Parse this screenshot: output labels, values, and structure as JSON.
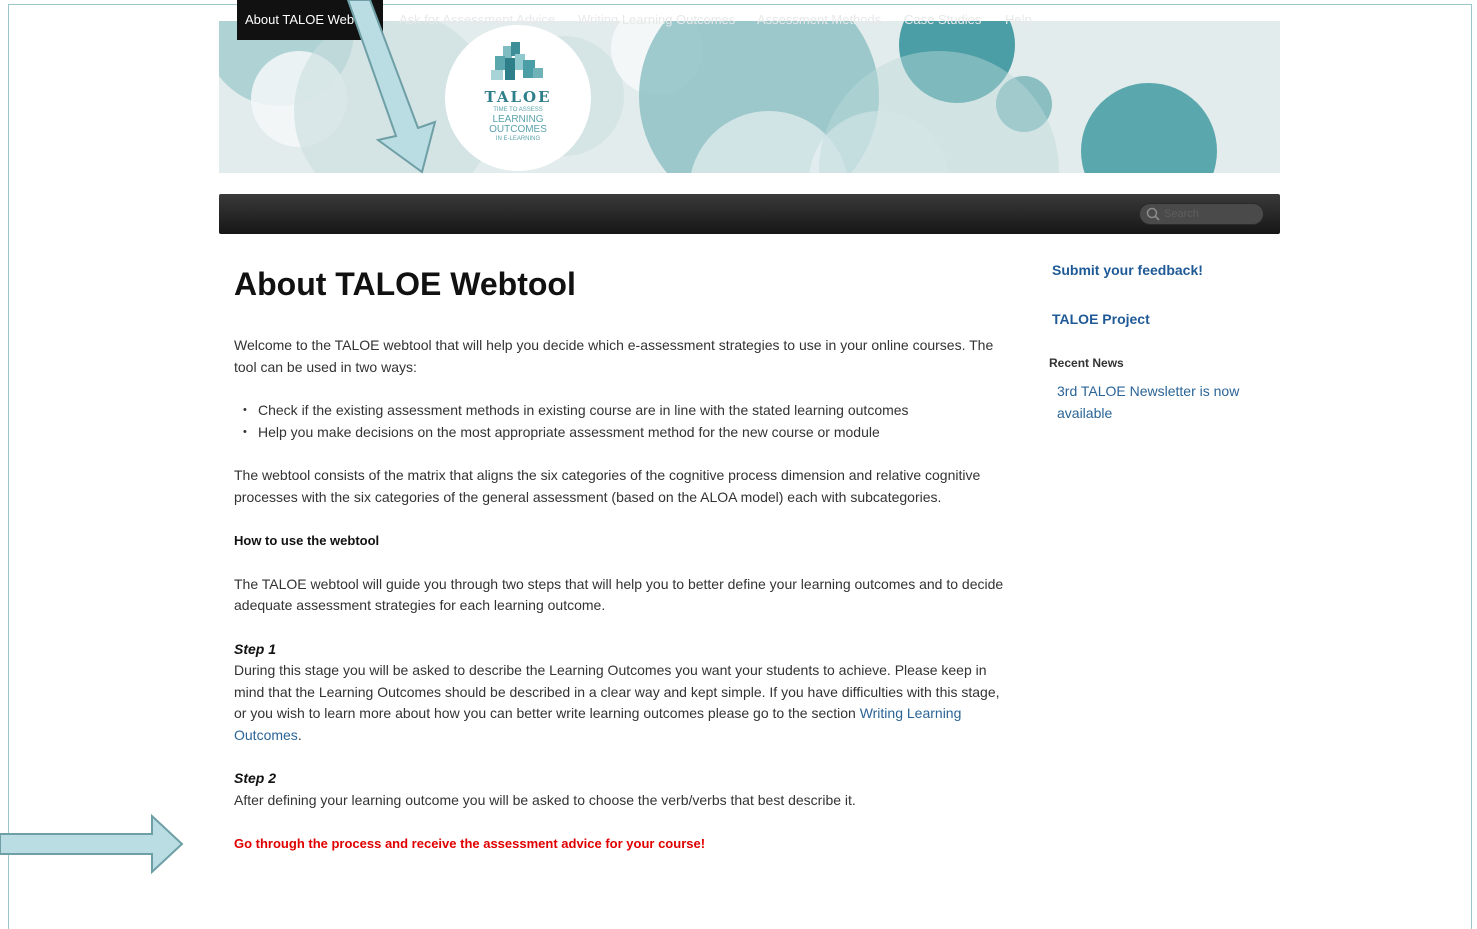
{
  "logo": {
    "word": "TALOE",
    "tagline_1": "TIME TO ASSESS",
    "tagline_2": "LEARNING",
    "tagline_3": "OUTCOMES",
    "tagline_4": "IN E-LEARNING"
  },
  "nav": {
    "items": [
      {
        "label": "About TALOE Webtool",
        "active": true
      },
      {
        "label": "Ask for Assessment Advice"
      },
      {
        "label": "Writing Learning Outcomes"
      },
      {
        "label": "Assessment Methods"
      },
      {
        "label": "Case Studies"
      },
      {
        "label": "Help"
      }
    ],
    "search_placeholder": "Search"
  },
  "main": {
    "title": "About TALOE Webtool",
    "intro": "Welcome to the TALOE webtool that will help you decide which e-assessment strategies to use in your online courses. The tool can be used in two ways:",
    "bullets": [
      "Check if the existing assessment methods in existing course are in line with the stated learning outcomes",
      "Help you make decisions on the most appropriate assessment method for the new course or module"
    ],
    "matrix_text": "The webtool consists of the matrix that aligns the six categories of the cognitive process dimension and relative cognitive processes with the six categories of the general assessment (based on the ALOA model) each with subcategories.",
    "how_to_heading": "How to use the webtool",
    "how_to_text": "The TALOE webtool will guide you through two steps that will help you to better define your learning outcomes and to decide adequate assessment strategies for each learning outcome.",
    "step1_title": "Step 1",
    "step1_text": "During this stage you will be asked to describe the Learning Outcomes you want your students to achieve. Please keep in mind that the Learning Outcomes should be described in a clear way and kept simple. If you have difficulties with this stage, or you wish to learn more about how you can better write learning outcomes please go to the section ",
    "step1_link": "Writing Learning Outcomes",
    "step1_end": ".",
    "step2_title": "Step 2",
    "step2_text": "After defining your learning outcome you will be asked to choose the verb/verbs that best describe it.",
    "cta": "Go through the process and receive the assessment advice for your course!"
  },
  "sidebar": {
    "feedback_link": "Submit your feedback!",
    "project_link": "TALOE Project",
    "recent_news_title": "Recent News",
    "news_item": "3rd TALOE Newsletter is now available"
  },
  "colors": {
    "accent_teal": "#5aa8ae",
    "link_blue": "#2a6496",
    "cta_red": "#e00000",
    "nav_dark": "#1c1c1c",
    "arrow_fill": "#b9dde2",
    "arrow_stroke": "#6e9fa6"
  }
}
